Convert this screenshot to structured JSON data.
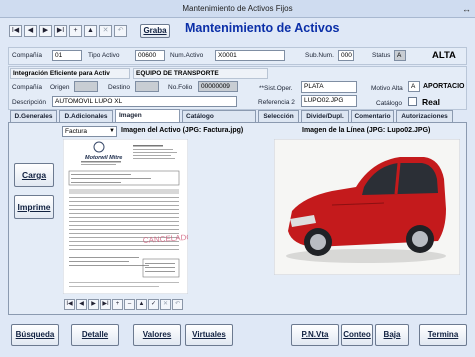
{
  "window": {
    "title": "Mantenimiento de Activos Fijos",
    "resize_glyph": "↔"
  },
  "toolbar": {
    "nav": [
      "I◀",
      "◀",
      "▶",
      "▶I",
      "+",
      "▲",
      "✕",
      "↶"
    ],
    "save_label": "Graba",
    "heading": "Mantenimiento de Activos"
  },
  "header": {
    "compania_label": "Compañía",
    "compania": "01",
    "tipo_label": "Tipo Activo",
    "tipo": "00600",
    "num_label": "Num.Activo",
    "num": "X0001",
    "subnum_label": "Sub.Num.",
    "subnum": "000",
    "status_label": "Status",
    "status": "A",
    "status_text": "ALTA"
  },
  "info": {
    "company_name": "Integración Eficiente para Activ",
    "category": "EQUIPO DE TRANSPORTE",
    "compania_label": "Compañía",
    "origen_label": "Origen",
    "destino_label": "Destino",
    "folio_label": "No.Folio",
    "folio": "00000009",
    "sist_label": "**Sist.Oper.",
    "sist": "PLATA",
    "motivo_label": "Motivo Alta",
    "motivo_code": "A",
    "motivo_text": "APORTACIO",
    "desc_label": "Descripción",
    "desc": "AUTOMOVIL LUPO XL",
    "ref2_label": "Referencia 2",
    "ref2": "LUPO02.JPG",
    "catalogo_label": "Catálogo",
    "real_label": "Real"
  },
  "tabs": [
    "D.Generales",
    "D.Adicionales",
    "Imagen",
    "Catálogo",
    "Selección",
    "Divide/Dupl.",
    "Comentario",
    "Autorizaciones"
  ],
  "imagen": {
    "select_value": "Factura",
    "asset_image_label": "Imagen del Activo (JPG: Factura.jpg)",
    "line_image_label": "Imagen de la Línea (JPG: Lupo02.JPG)",
    "carga": "Carga",
    "imprime": "Imprime",
    "invoice_brand": "Motorwil Mitre",
    "invoice_stamp": "CANCELADO",
    "nav": [
      "I◀",
      "◀",
      "▶",
      "▶I",
      "+",
      "–",
      "▲",
      "✓",
      "✕",
      "↶"
    ]
  },
  "footer": {
    "buttons": [
      "Búsqueda",
      "Detalle",
      "Valores",
      "Virtuales",
      "P.N.Vta",
      "Conteo",
      "Baja",
      "Termina"
    ]
  },
  "colors": {
    "heading": "#0b2fa8",
    "car_red": "#c41a1c",
    "background": "#dfe8f6"
  }
}
